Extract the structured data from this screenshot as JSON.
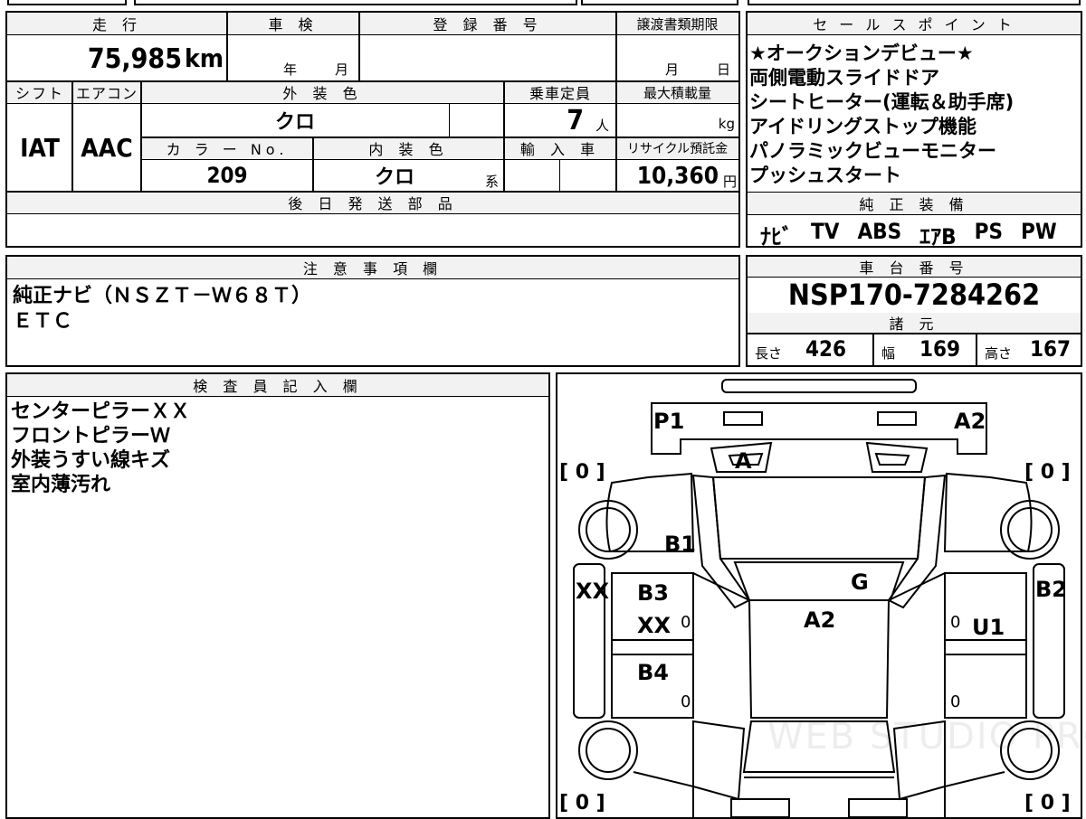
{
  "top_strip": {
    "partial_text": ""
  },
  "main": {
    "mileage_label": "走 行",
    "mileage_value": "75,985",
    "mileage_unit": "km",
    "inspection_label": "車 検",
    "inspection_year": "年",
    "inspection_month": "月",
    "registration_label": "登 録 番 号",
    "registration_value": "",
    "transfer_deadline_label": "譲渡書類期限",
    "transfer_month": "月",
    "transfer_day": "日",
    "shift_label": "シフト",
    "shift_value": "IAT",
    "aircon_label": "エアコン",
    "aircon_value": "AAC",
    "exterior_color_label": "外 装 色",
    "exterior_color_value": "クロ",
    "capacity_label": "乗車定員",
    "capacity_value": "7",
    "capacity_unit": "人",
    "max_load_label": "最大積載量",
    "max_load_unit": "kg",
    "color_no_label": "カ ラ ー No.",
    "color_no_value": "209",
    "interior_color_label": "内 装 色",
    "interior_color_value": "クロ",
    "interior_color_suffix": "系",
    "import_label": "輸 入 車",
    "recycle_label": "リサイクル預託金",
    "recycle_value": "10,360",
    "recycle_unit": "円",
    "later_parts_label": "後 日 発 送 部 品",
    "later_parts_value": ""
  },
  "sales_points": {
    "title": "セ ー ル ス ポ イ ン ト",
    "items": [
      "★オークションデビュー★",
      "両側電動スライドドア",
      "シートヒーター(運転＆助手席)",
      "アイドリングストップ機能",
      "パノラミックビューモニター",
      "プッシュスタート"
    ]
  },
  "genuine_equipment": {
    "title": "純 正 装 備",
    "items": [
      "ﾅﾋﾞ",
      "TV",
      "ABS",
      "ｴｱB",
      "PS",
      "PW"
    ]
  },
  "notes": {
    "title": "注 意 事 項 欄",
    "lines": [
      "純正ナビ（ＮＳＺＴ－Ｗ６８Ｔ）",
      "ＥＴＣ"
    ]
  },
  "chassis": {
    "title": "車 台 番 号",
    "value": "NSP170-7284262",
    "specs_title": "諸 元",
    "length_label": "長さ",
    "length_value": "426",
    "width_label": "幅",
    "width_value": "169",
    "height_label": "高さ",
    "height_value": "167"
  },
  "inspector": {
    "title": "検 査 員 記 入 欄",
    "lines": [
      "センターピラーＸＸ",
      "フロントピラーＷ",
      "外装うすい線キズ",
      "室内薄汚れ"
    ]
  },
  "diagram": {
    "tire_front_left": "[ 0 ]",
    "tire_front_right": "[ 0 ]",
    "tire_rear_left": "[ 0 ]",
    "tire_rear_right": "[ 0 ]",
    "marks": {
      "p1": "P1",
      "a2_front": "A2",
      "a": "A",
      "b1": "B1",
      "g": "G",
      "xx_left": "XX",
      "b3": "B3",
      "xx_door": "XX",
      "a2_roof": "A2",
      "b2": "B2",
      "u1": "U1",
      "b4": "B4"
    },
    "zeros": [
      "0",
      "0",
      "0",
      "0"
    ],
    "watermark": "WEB STUDIO PRO"
  }
}
